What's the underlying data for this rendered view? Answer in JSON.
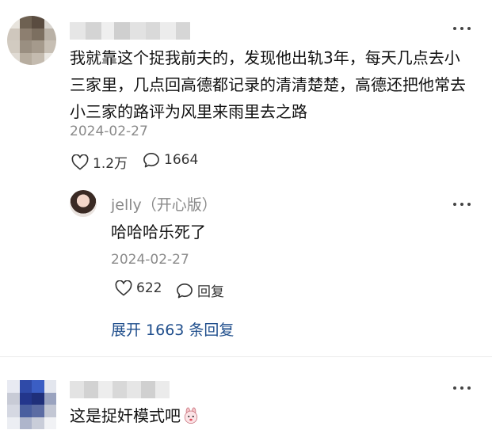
{
  "comment1": {
    "text": "我就靠这个捉我前夫的，发现他出轨3年，每天几点去小三家里，几点回高德都记录的清清楚楚，高德还把他常去小三家的路评为风里来雨里去之路",
    "date": "2024-02-27",
    "likes": "1.2万",
    "replies": "1664"
  },
  "reply1": {
    "author": "jelly（开心版）",
    "text": "哈哈哈乐死了",
    "date": "2024-02-27",
    "likes": "622",
    "reply_label": "回复"
  },
  "expand_label": "展开 1663 条回复",
  "comment2": {
    "text": "这是捉奸模式吧",
    "emoji": "rabbit-face-emoji"
  },
  "icons": {
    "more": "more-dots-icon",
    "like": "heart-icon",
    "comment": "comment-bubble-icon"
  }
}
